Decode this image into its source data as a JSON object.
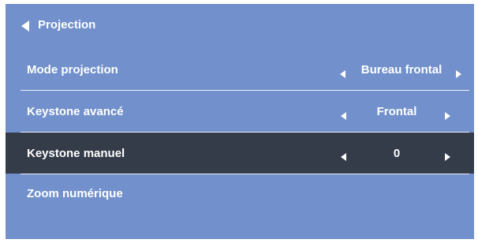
{
  "menu": {
    "title": "Projection",
    "items": [
      {
        "label": "Mode projection",
        "value": "Bureau frontal"
      },
      {
        "label": "Keystone avancé",
        "value": "Frontal"
      },
      {
        "label": "Keystone manuel",
        "value": "0",
        "selected": true
      },
      {
        "label": "Zoom numérique",
        "value": ""
      }
    ]
  },
  "colors": {
    "panel_bg": "#7290cb",
    "selected_row_bg": "#343b49",
    "text": "#ffffff",
    "divider": "#eef2fb"
  },
  "icons": {
    "back": "triangle-left",
    "decrease": "triangle-left",
    "increase": "triangle-right"
  }
}
